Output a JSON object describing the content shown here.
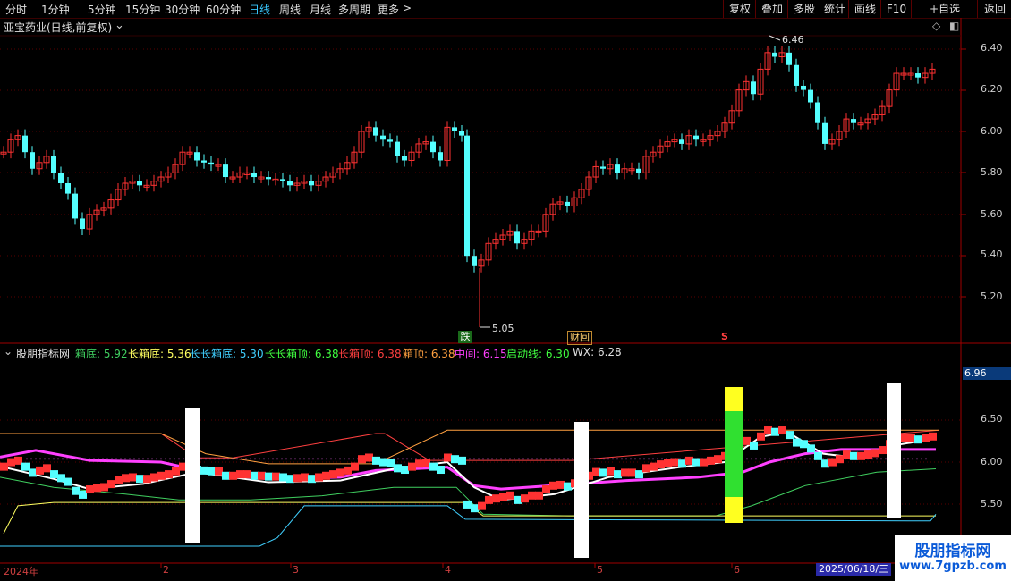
{
  "toolbar": {
    "periods": [
      "分时",
      "1分钟",
      "5分钟",
      "15分钟",
      "30分钟",
      "60分钟",
      "日线",
      "周线",
      "月线",
      "多周期",
      "更多"
    ],
    "more_arrow": ">",
    "active_period": "日线",
    "right_buttons": [
      "复权",
      "叠加",
      "多股",
      "统计",
      "画线",
      "F10",
      "+自选",
      "返回"
    ]
  },
  "main_chart": {
    "title": "亚宝药业(日线,前复权)",
    "price_axis": [
      "6.40",
      "6.20",
      "6.00",
      "5.80",
      "5.60",
      "5.40",
      "5.20"
    ],
    "high_label": "6.46",
    "low_label": "5.05",
    "badges": {
      "drop": "跌",
      "finance": "财回",
      "s": "S"
    }
  },
  "indicator": {
    "name": "股朋指标网",
    "items": [
      {
        "label": "箱底: 5.92",
        "color": "#40d060"
      },
      {
        "label": "长箱底: 5.36",
        "color": "#ffff60"
      },
      {
        "label": "长长箱底: 5.30",
        "color": "#40d0ff"
      },
      {
        "label": "长长箱顶: 6.38",
        "color": "#40ff40"
      },
      {
        "label": "长箱顶: 6.38",
        "color": "#ff4040"
      },
      {
        "label": "箱顶: 6.38",
        "color": "#ffa040"
      },
      {
        "label": "中间: 6.15",
        "color": "#ff40ff"
      },
      {
        "label": "启动线: 6.30",
        "color": "#40ff40"
      },
      {
        "label": "WX: 6.28",
        "color": "#e0e0e0"
      }
    ],
    "axis": [
      "6.50",
      "6.00",
      "5.50"
    ],
    "current_value": "6.96"
  },
  "x_axis": {
    "labels": [
      "2024年",
      "2",
      "3",
      "4",
      "5",
      "6"
    ],
    "cursor_date": "2025/06/18/三"
  },
  "watermark": {
    "line1": "股朋指标网",
    "line2": "www.7gpzb.com"
  },
  "colors": {
    "up": "#ff3232",
    "down": "#54ffff",
    "border": "#a00000",
    "accent": "#38c8ff"
  }
}
